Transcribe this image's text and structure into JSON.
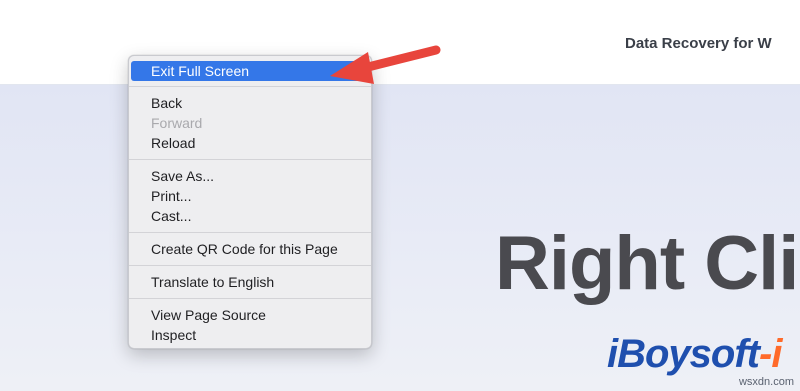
{
  "header": {
    "title": "Data Recovery for W"
  },
  "hero": {
    "title": "Right Clic"
  },
  "brand": {
    "logo_main": "iBoysoft",
    "logo_suffix": "-i"
  },
  "watermark": "wsxdn.com",
  "context_menu": {
    "groups": [
      [
        {
          "label": "Exit Full Screen",
          "state": "highlighted"
        }
      ],
      [
        {
          "label": "Back",
          "state": "enabled"
        },
        {
          "label": "Forward",
          "state": "disabled"
        },
        {
          "label": "Reload",
          "state": "enabled"
        }
      ],
      [
        {
          "label": "Save As...",
          "state": "enabled"
        },
        {
          "label": "Print...",
          "state": "enabled"
        },
        {
          "label": "Cast...",
          "state": "enabled"
        }
      ],
      [
        {
          "label": "Create QR Code for this Page",
          "state": "enabled"
        }
      ],
      [
        {
          "label": "Translate to English",
          "state": "enabled"
        }
      ],
      [
        {
          "label": "View Page Source",
          "state": "enabled"
        },
        {
          "label": "Inspect",
          "state": "enabled"
        }
      ]
    ]
  },
  "annotation": {
    "arrow_color": "#e8453c",
    "target": "Exit Full Screen"
  },
  "colors": {
    "highlight": "#3477e8",
    "brand_blue": "#1f4fae",
    "brand_orange": "#ff6a2a"
  }
}
